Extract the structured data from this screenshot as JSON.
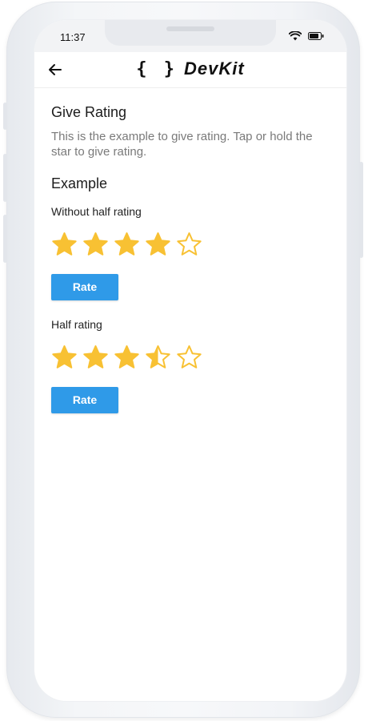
{
  "status": {
    "time": "11:37"
  },
  "appbar": {
    "logo_braces": "{ }",
    "logo_name": "DevKit"
  },
  "content": {
    "title": "Give Rating",
    "description": "This is the example to give rating. Tap or hold the star to give rating.",
    "example_heading": "Example",
    "sections": [
      {
        "label": "Without half rating",
        "rating": 4,
        "max": 5,
        "button": "Rate"
      },
      {
        "label": "Half rating",
        "rating": 3.5,
        "max": 5,
        "button": "Rate"
      }
    ]
  },
  "colors": {
    "star": "#F8C133",
    "button": "#2F9AE8",
    "text_secondary": "#7A7A7A"
  },
  "icons": {
    "back": "arrow-left-icon",
    "wifi": "wifi-icon",
    "battery": "battery-icon",
    "star_full": "star-filled-icon",
    "star_half": "star-half-icon",
    "star_empty": "star-outline-icon"
  }
}
